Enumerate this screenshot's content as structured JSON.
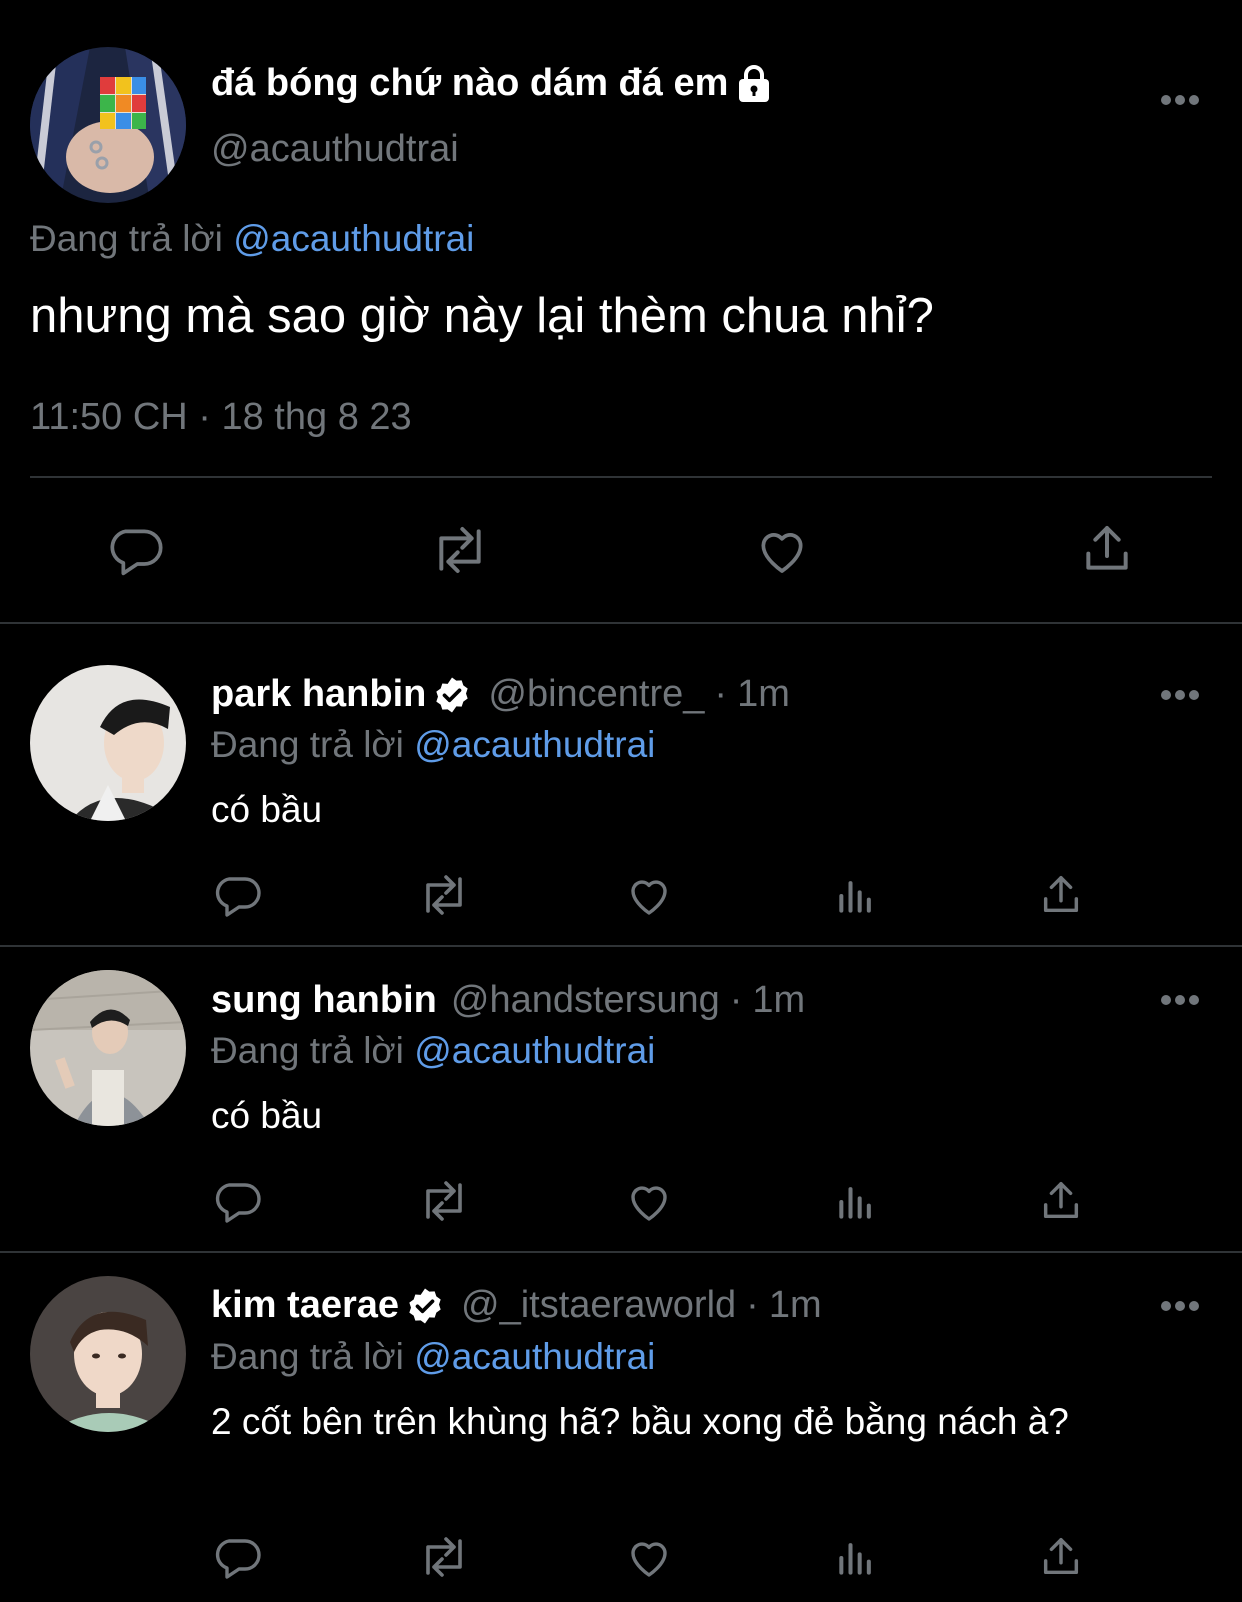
{
  "main_tweet": {
    "display_name": "đá bóng chứ nào dám đá em",
    "handle": "@acauthudtrai",
    "replying_prefix": "Đang trả lời",
    "replying_to": "@acauthudtrai",
    "text": "nhưng mà sao giờ này lại thèm chua nhỉ?",
    "timestamp": "11:50 CH · 18 thg 8 23",
    "icons": [
      "lock-icon",
      "more-icon",
      "reply-icon",
      "retweet-icon",
      "like-icon",
      "share-icon"
    ]
  },
  "replies": [
    {
      "display_name": "park hanbin",
      "verified": true,
      "handle": "@bincentre_",
      "dot": "·",
      "time": "1m",
      "replying_prefix": "Đang trả lời",
      "replying_to": "@acauthudtrai",
      "text": "có bầu"
    },
    {
      "display_name": "sung hanbin",
      "verified": false,
      "handle": "@handstersung",
      "dot": "·",
      "time": "1m",
      "replying_prefix": "Đang trả lời",
      "replying_to": "@acauthudtrai",
      "text": "có bầu"
    },
    {
      "display_name": "kim taerae",
      "verified": true,
      "handle": "@_itstaeraworld",
      "dot": "·",
      "time": "1m",
      "replying_prefix": "Đang trả lời",
      "replying_to": "@acauthudtrai",
      "text": "2 cốt bên trên khùng hã? bầu xong đẻ bằng nách à?"
    }
  ],
  "colors": {
    "background": "#000000",
    "text": "#ffffff",
    "secondary": "#71767b",
    "mention": "#5f9ce8",
    "divider": "#2f3336"
  }
}
